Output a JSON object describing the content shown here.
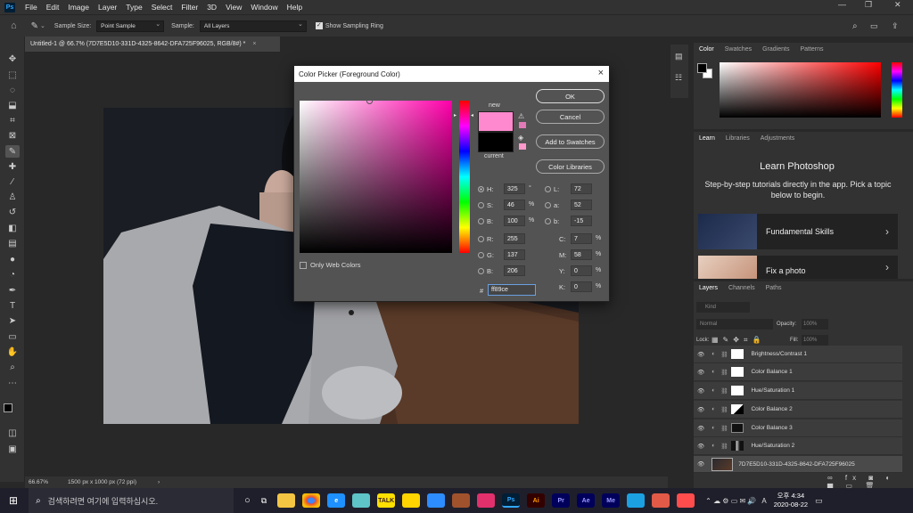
{
  "app": {
    "logo": "Ps"
  },
  "menu": [
    "File",
    "Edit",
    "Image",
    "Layer",
    "Type",
    "Select",
    "Filter",
    "3D",
    "View",
    "Window",
    "Help"
  ],
  "options": {
    "sample_size_label": "Sample Size:",
    "sample_size_value": "Point Sample",
    "sample_label": "Sample:",
    "sample_value": "All Layers",
    "show_ring_label": "Show Sampling Ring"
  },
  "document_tab": {
    "title": "Untitled-1 @ 66.7% (7D7E5D10-331D-4325-8642-DFA725F96025, RGB/8#) *",
    "close": "×"
  },
  "status": {
    "zoom": "66.67%",
    "info": "1500 px x 1000 px (72 ppi)",
    "arrow": "›"
  },
  "color_panel": {
    "tabs": [
      "Color",
      "Swatches",
      "Gradients",
      "Patterns"
    ]
  },
  "learn_panel": {
    "tabs": [
      "Learn",
      "Libraries",
      "Adjustments"
    ],
    "title": "Learn Photoshop",
    "desc": "Step-by-step tutorials directly in the app. Pick a topic below to begin.",
    "cards": [
      "Fundamental Skills",
      "Fix a photo"
    ]
  },
  "layers_panel": {
    "tabs": [
      "Layers",
      "Channels",
      "Paths"
    ],
    "kind_placeholder": "Kind",
    "blend_mode": "Normal",
    "opacity_label": "Opacity:",
    "opacity_value": "100%",
    "lock_label": "Lock:",
    "fill_label": "Fill:",
    "fill_value": "100%",
    "layers": [
      "Brightness/Contrast 1",
      "Color Balance 1",
      "Hue/Saturation 1",
      "Color Balance 2",
      "Color Balance 3",
      "Hue/Saturation 2",
      "7D7E5D10-331D-4325-8642-DFA725F96025"
    ]
  },
  "dialog": {
    "title": "Color Picker (Foreground Color)",
    "close": "×",
    "new_label": "new",
    "current_label": "current",
    "new_color": "#ff89ce",
    "current_color": "#000000",
    "buttons": {
      "ok": "OK",
      "cancel": "Cancel",
      "add": "Add to Swatches",
      "libraries": "Color Libraries"
    },
    "only_web": "Only Web Colors",
    "hsb": {
      "h_label": "H:",
      "h": "325",
      "h_unit": "°",
      "s_label": "S:",
      "s": "46",
      "s_unit": "%",
      "b_label": "B:",
      "b": "100",
      "b_unit": "%"
    },
    "rgb": {
      "r_label": "R:",
      "r": "255",
      "g_label": "G:",
      "g": "137",
      "b_label": "B:",
      "b": "206"
    },
    "lab": {
      "l_label": "L:",
      "l": "72",
      "a_label": "a:",
      "a": "52",
      "b_label": "b:",
      "b": "-15"
    },
    "cmyk": {
      "c_label": "C:",
      "c": "7",
      "m_label": "M:",
      "m": "58",
      "y_label": "Y:",
      "y": "0",
      "k_label": "K:",
      "k": "0",
      "unit": "%"
    },
    "hex_label": "#",
    "hex": "ff89ce"
  },
  "taskbar": {
    "search_placeholder": "검색하려면 여기에 입력하십시오.",
    "time": "오후 4:34",
    "date": "2020-08-22",
    "lang": "A",
    "app_icons": [
      "Ps",
      "Ai",
      "Pr",
      "Ae",
      "Me"
    ]
  }
}
